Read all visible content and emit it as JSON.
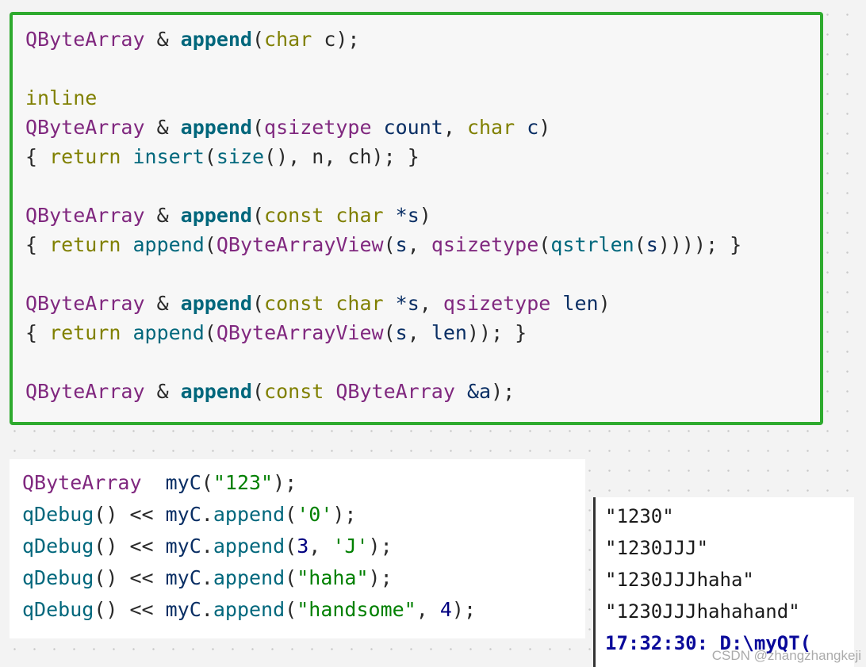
{
  "code_top": [
    [
      {
        "t": "QByteArray",
        "c": "cls"
      },
      {
        "t": " & ",
        "c": "pl"
      },
      {
        "t": "append",
        "c": "fn"
      },
      {
        "t": "(",
        "c": "pl"
      },
      {
        "t": "char",
        "c": "kw"
      },
      {
        "t": " c);",
        "c": "pl"
      }
    ],
    [],
    [
      {
        "t": "inline",
        "c": "kw"
      }
    ],
    [
      {
        "t": "QByteArray",
        "c": "cls"
      },
      {
        "t": " & ",
        "c": "pl"
      },
      {
        "t": "append",
        "c": "fn"
      },
      {
        "t": "(",
        "c": "pl"
      },
      {
        "t": "qsizetype",
        "c": "cls"
      },
      {
        "t": " ",
        "c": "pl"
      },
      {
        "t": "count",
        "c": "var"
      },
      {
        "t": ", ",
        "c": "pl"
      },
      {
        "t": "char",
        "c": "kw"
      },
      {
        "t": " ",
        "c": "pl"
      },
      {
        "t": "c",
        "c": "var"
      },
      {
        "t": ")",
        "c": "pl"
      }
    ],
    [
      {
        "t": "{ ",
        "c": "pl"
      },
      {
        "t": "return",
        "c": "kw"
      },
      {
        "t": " ",
        "c": "pl"
      },
      {
        "t": "insert",
        "c": "call"
      },
      {
        "t": "(",
        "c": "pl"
      },
      {
        "t": "size",
        "c": "call"
      },
      {
        "t": "(), n, ch); }",
        "c": "pl"
      }
    ],
    [],
    [
      {
        "t": "QByteArray",
        "c": "cls"
      },
      {
        "t": " & ",
        "c": "pl"
      },
      {
        "t": "append",
        "c": "fn"
      },
      {
        "t": "(",
        "c": "pl"
      },
      {
        "t": "const",
        "c": "kw"
      },
      {
        "t": " ",
        "c": "pl"
      },
      {
        "t": "char",
        "c": "kw"
      },
      {
        "t": " ",
        "c": "pl"
      },
      {
        "t": "*s",
        "c": "var"
      },
      {
        "t": ")",
        "c": "pl"
      }
    ],
    [
      {
        "t": "{ ",
        "c": "pl"
      },
      {
        "t": "return",
        "c": "kw"
      },
      {
        "t": " ",
        "c": "pl"
      },
      {
        "t": "append",
        "c": "call"
      },
      {
        "t": "(",
        "c": "pl"
      },
      {
        "t": "QByteArrayView",
        "c": "cls"
      },
      {
        "t": "(",
        "c": "pl"
      },
      {
        "t": "s",
        "c": "var"
      },
      {
        "t": ", ",
        "c": "pl"
      },
      {
        "t": "qsizetype",
        "c": "cls"
      },
      {
        "t": "(",
        "c": "pl"
      },
      {
        "t": "qstrlen",
        "c": "call"
      },
      {
        "t": "(",
        "c": "pl"
      },
      {
        "t": "s",
        "c": "var"
      },
      {
        "t": ")))); }",
        "c": "pl"
      }
    ],
    [],
    [
      {
        "t": "QByteArray",
        "c": "cls"
      },
      {
        "t": " & ",
        "c": "pl"
      },
      {
        "t": "append",
        "c": "fn"
      },
      {
        "t": "(",
        "c": "pl"
      },
      {
        "t": "const",
        "c": "kw"
      },
      {
        "t": " ",
        "c": "pl"
      },
      {
        "t": "char",
        "c": "kw"
      },
      {
        "t": " ",
        "c": "pl"
      },
      {
        "t": "*s",
        "c": "var"
      },
      {
        "t": ", ",
        "c": "pl"
      },
      {
        "t": "qsizetype",
        "c": "cls"
      },
      {
        "t": " ",
        "c": "pl"
      },
      {
        "t": "len",
        "c": "var"
      },
      {
        "t": ")",
        "c": "pl"
      }
    ],
    [
      {
        "t": "{ ",
        "c": "pl"
      },
      {
        "t": "return",
        "c": "kw"
      },
      {
        "t": " ",
        "c": "pl"
      },
      {
        "t": "append",
        "c": "call"
      },
      {
        "t": "(",
        "c": "pl"
      },
      {
        "t": "QByteArrayView",
        "c": "cls"
      },
      {
        "t": "(",
        "c": "pl"
      },
      {
        "t": "s",
        "c": "var"
      },
      {
        "t": ", ",
        "c": "pl"
      },
      {
        "t": "len",
        "c": "var"
      },
      {
        "t": ")); }",
        "c": "pl"
      }
    ],
    [],
    [
      {
        "t": "QByteArray",
        "c": "cls"
      },
      {
        "t": " & ",
        "c": "pl"
      },
      {
        "t": "append",
        "c": "fn"
      },
      {
        "t": "(",
        "c": "pl"
      },
      {
        "t": "const",
        "c": "kw"
      },
      {
        "t": " ",
        "c": "pl"
      },
      {
        "t": "QByteArray",
        "c": "cls"
      },
      {
        "t": " ",
        "c": "pl"
      },
      {
        "t": "&a",
        "c": "var"
      },
      {
        "t": ");",
        "c": "pl"
      }
    ]
  ],
  "code_bottom": [
    [
      {
        "t": "QByteArray",
        "c": "cls"
      },
      {
        "t": "  ",
        "c": "pl"
      },
      {
        "t": "myC",
        "c": "var"
      },
      {
        "t": "(",
        "c": "pl"
      },
      {
        "t": "\"123\"",
        "c": "str"
      },
      {
        "t": ");",
        "c": "pl"
      }
    ],
    [
      {
        "t": "qDebug",
        "c": "call"
      },
      {
        "t": "() << ",
        "c": "pl"
      },
      {
        "t": "myC",
        "c": "var"
      },
      {
        "t": ".",
        "c": "pl"
      },
      {
        "t": "append",
        "c": "call"
      },
      {
        "t": "(",
        "c": "pl"
      },
      {
        "t": "'0'",
        "c": "str"
      },
      {
        "t": ");",
        "c": "pl"
      }
    ],
    [
      {
        "t": "qDebug",
        "c": "call"
      },
      {
        "t": "() << ",
        "c": "pl"
      },
      {
        "t": "myC",
        "c": "var"
      },
      {
        "t": ".",
        "c": "pl"
      },
      {
        "t": "append",
        "c": "call"
      },
      {
        "t": "(",
        "c": "pl"
      },
      {
        "t": "3",
        "c": "num"
      },
      {
        "t": ", ",
        "c": "pl"
      },
      {
        "t": "'J'",
        "c": "str"
      },
      {
        "t": ");",
        "c": "pl"
      }
    ],
    [
      {
        "t": "qDebug",
        "c": "call"
      },
      {
        "t": "() << ",
        "c": "pl"
      },
      {
        "t": "myC",
        "c": "var"
      },
      {
        "t": ".",
        "c": "pl"
      },
      {
        "t": "append",
        "c": "call"
      },
      {
        "t": "(",
        "c": "pl"
      },
      {
        "t": "\"haha\"",
        "c": "str"
      },
      {
        "t": ");",
        "c": "pl"
      }
    ],
    [
      {
        "t": "qDebug",
        "c": "call"
      },
      {
        "t": "() << ",
        "c": "pl"
      },
      {
        "t": "myC",
        "c": "var"
      },
      {
        "t": ".",
        "c": "pl"
      },
      {
        "t": "append",
        "c": "call"
      },
      {
        "t": "(",
        "c": "pl"
      },
      {
        "t": "\"handsome\"",
        "c": "str"
      },
      {
        "t": ", ",
        "c": "pl"
      },
      {
        "t": "4",
        "c": "num"
      },
      {
        "t": ");",
        "c": "pl"
      }
    ]
  ],
  "output": {
    "lines": [
      "\"1230\"",
      "\"1230JJJ\"",
      "\"1230JJJhaha\"",
      "\"1230JJJhahahand\""
    ],
    "status": "17:32:30: D:\\myQT("
  },
  "watermark": "CSDN @zhangzhangkeji",
  "colors": {
    "frame_green": "#2eaa2e",
    "class_purple": "#80287f",
    "function_teal": "#00677c",
    "keyword_olive": "#808000",
    "variable_navy": "#092e64",
    "string_green": "#008000",
    "status_blue": "#0a0a9a"
  }
}
